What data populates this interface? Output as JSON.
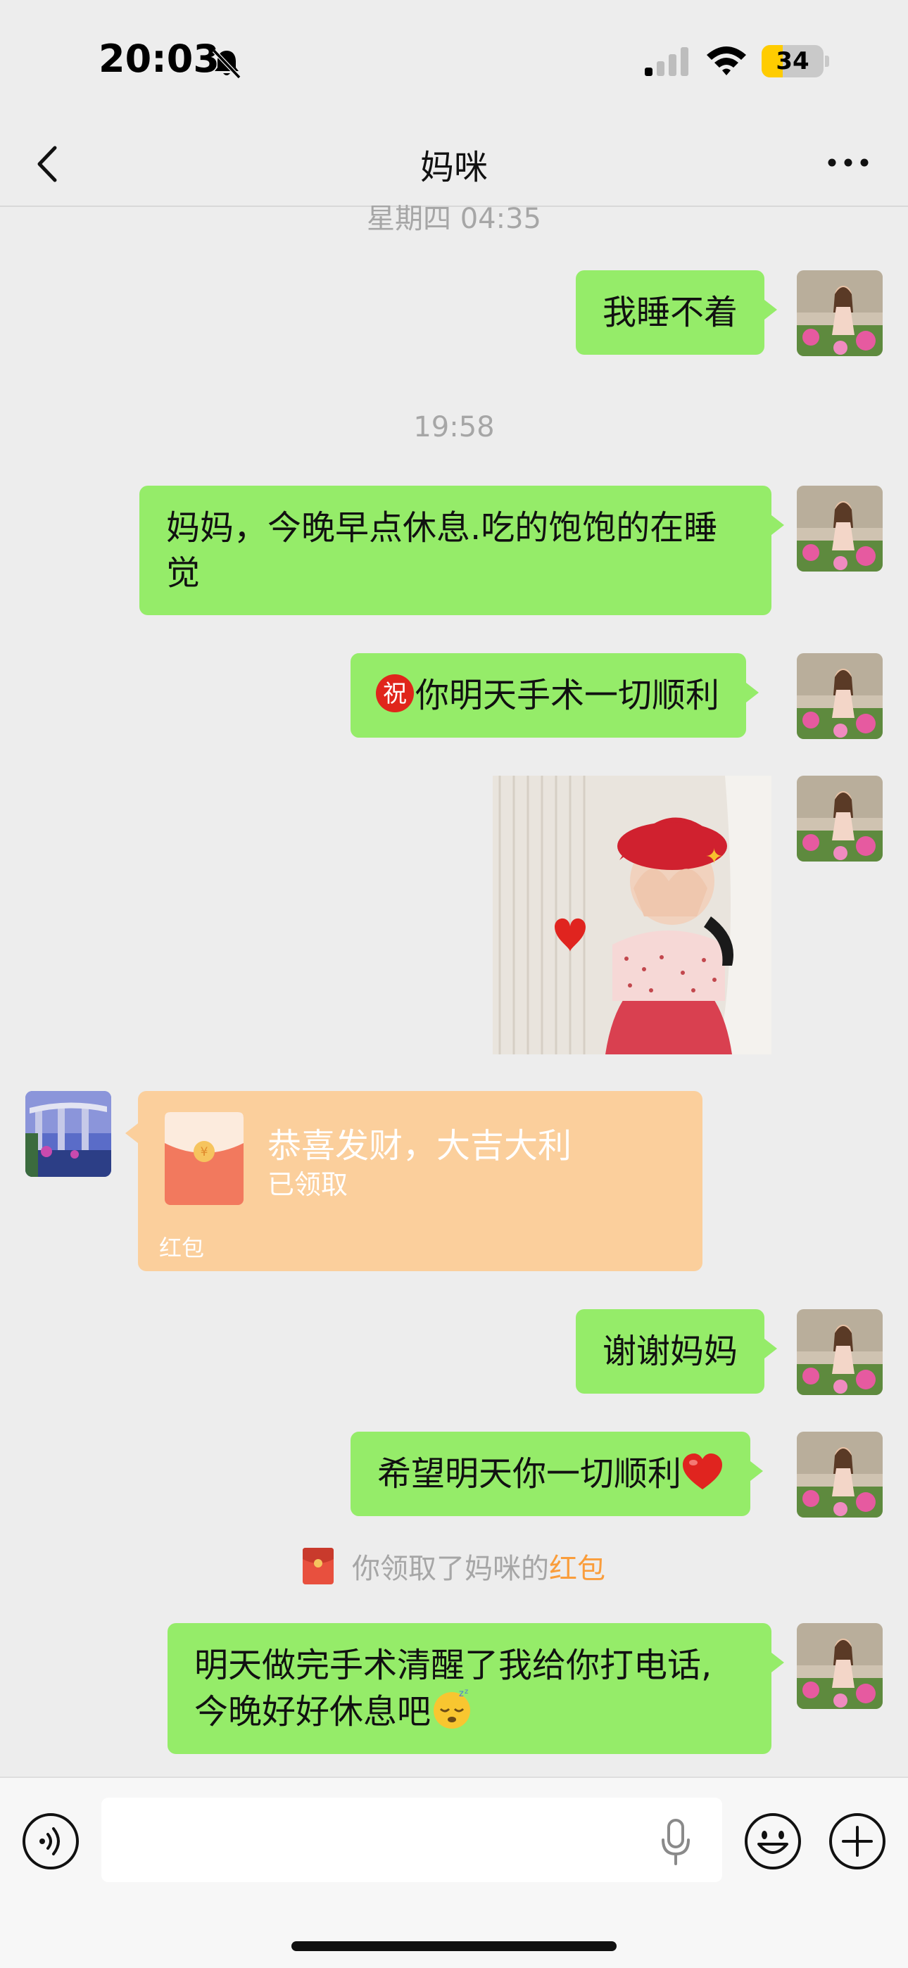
{
  "status_bar": {
    "time": "20:03",
    "battery": "34",
    "battery_level": 0.34,
    "icons": [
      "bell-slash-icon",
      "cellular-signal-icon",
      "wifi-icon",
      "battery-icon"
    ]
  },
  "nav": {
    "title": "妈咪",
    "back_icon": "chevron-left-icon",
    "more_icon": "ellipsis-icon"
  },
  "chat": {
    "cut_timestamp": "星期四 04:35",
    "timestamp_2": "19:58",
    "messages": [
      {
        "text": "我睡不着"
      },
      {
        "line1": "妈妈，今晚早点休息.吃的饱饱的在睡",
        "line2": "觉"
      },
      {
        "text": "你明天手术一切顺利",
        "prefix_icon": "congratulation-icon"
      },
      {
        "image": "photo-girl-red-beret"
      },
      {
        "text": "谢谢妈妈"
      },
      {
        "text": "希望明天你一切顺利",
        "suffix_icon": "red-heart-icon"
      },
      {
        "line1": "明天做完手术清醒了我给你打电话,",
        "line2": "今晚好好休息吧",
        "suffix_icon": "sleeping-face-icon"
      }
    ],
    "red_packet": {
      "title": "恭喜发财，大吉大利",
      "status": "已领取",
      "label": "红包"
    },
    "system_notice": {
      "prefix": "你领取了妈咪的",
      "link": "红包"
    }
  },
  "input_bar": {
    "placeholder": "",
    "icons": [
      "voice-icon",
      "microphone-icon",
      "emoji-icon",
      "plus-icon"
    ]
  },
  "colors": {
    "background": "#EDEDED",
    "bubble_green": "#95EC69",
    "red_packet": "#FBCF9C",
    "timestamp_gray": "#A6A6A6",
    "link_orange": "#FA9D3B"
  }
}
